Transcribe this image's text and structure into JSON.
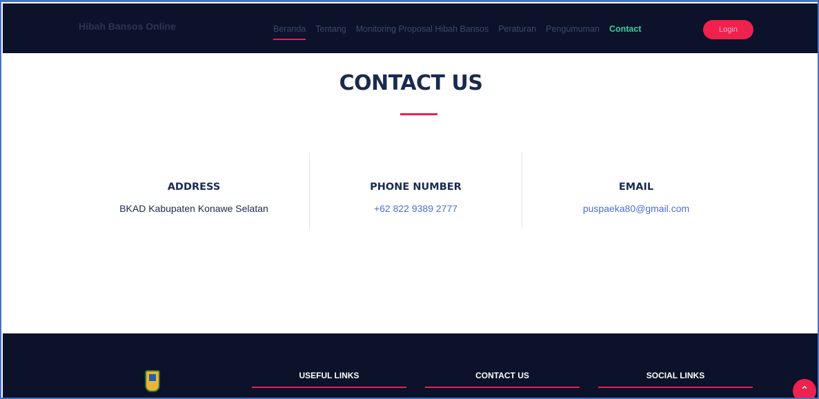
{
  "header": {
    "brand": "Hibah Bansos Online",
    "nav": [
      {
        "label": "Beranda"
      },
      {
        "label": "Tentang"
      },
      {
        "label": "Monitoring Proposal Hibah Bansos"
      },
      {
        "label": "Peraturan"
      },
      {
        "label": "Pengumuman"
      },
      {
        "label": "Contact"
      }
    ],
    "login_label": "Login"
  },
  "contact": {
    "title": "CONTACT US",
    "address": {
      "heading": "ADDRESS",
      "value": "BKAD Kabupaten Konawe Selatan"
    },
    "phone": {
      "heading": "PHONE NUMBER",
      "value": "+62 822 9389 2777"
    },
    "email": {
      "heading": "EMAIL",
      "value": "puspaeka80@gmail.com"
    }
  },
  "footer": {
    "useful_links": "USEFUL LINKS",
    "contact_us": "CONTACT US",
    "social_links": "SOCIAL LINKS"
  },
  "icons": {
    "logo": "regency-emblem-icon",
    "back_to_top": "chevron-up-icon"
  },
  "colors": {
    "navy": "#0b1229",
    "accent": "#e9204f",
    "heading": "#1a2a4f",
    "link": "#4a6fd6",
    "active_nav": "#3ad1a0"
  }
}
